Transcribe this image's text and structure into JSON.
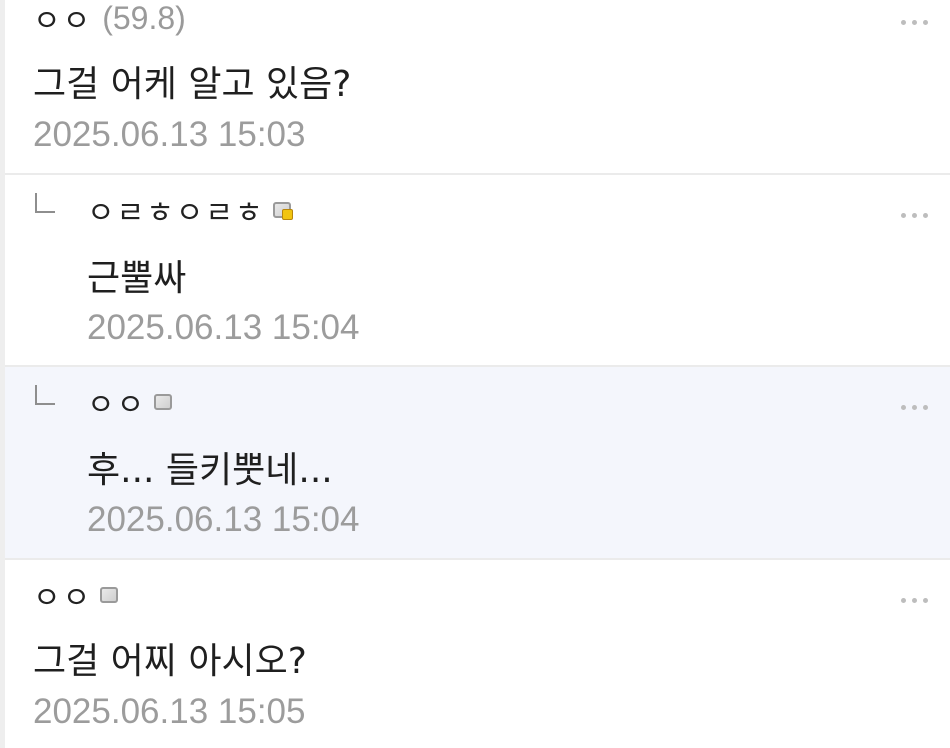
{
  "comments": [
    {
      "author": "ㅇㅇ",
      "ip": "(59.8)",
      "body": "그걸 어케 알고 있음?",
      "date": "2025.06.13 15:03"
    },
    {
      "author": "ㅇㄹㅎㅇㄹㅎ",
      "body": "근뿔싸",
      "date": "2025.06.13 15:04"
    },
    {
      "author": "ㅇㅇ",
      "body": "후... 들키뿟네...",
      "date": "2025.06.13 15:04"
    },
    {
      "author": "ㅇㅇ",
      "body": "그걸 어찌 아시오?",
      "date": "2025.06.13 15:05"
    }
  ],
  "icons": {
    "more": "more-dots-icon",
    "reply": "reply-arrow-icon",
    "member_badge": "member-badge-icon",
    "fixed_member_badge": "fixed-member-badge-icon"
  }
}
